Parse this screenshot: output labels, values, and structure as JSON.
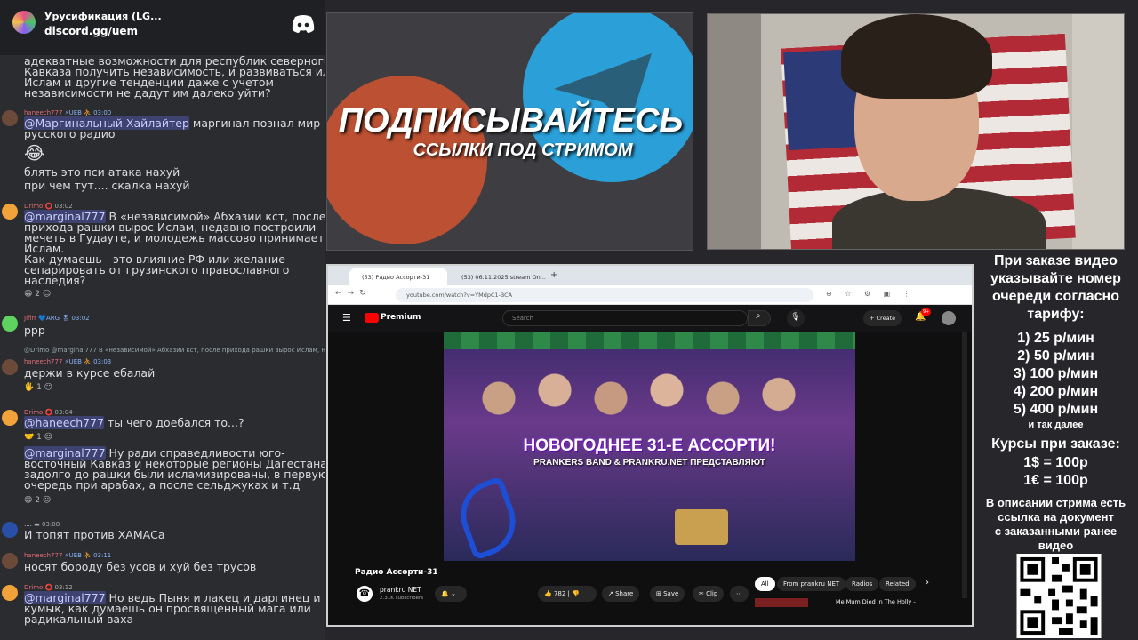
{
  "discord": {
    "title": "Урусификация (LG...",
    "invite": "discord.gg/uem"
  },
  "chat": {
    "m0": {
      "lines": "адекватные возможности для республик северного\nКавказа получить независимость, и развиваться или\nИслам и другие тенденции даже с учетом\nнезависимости не дадут им далеко уйти?"
    },
    "m1": {
      "user": "haneech777",
      "meta": "⚡UEB ⛹ 03:00",
      "mention": "@Маргинальный Хайлайтер",
      "text": " маргинал познал мир",
      "text2": "русского радио"
    },
    "m1b": {
      "emoji": "😂",
      "l1": "блять это пси атака нахуй",
      "l2": "при чем тут.... скалка нахуй"
    },
    "m2": {
      "user": "Drimo",
      "meta": "⭕ 03:02",
      "mention": "@marginal777",
      "text": " В «независимой» Абхазии кст, после",
      "rest": "прихода рашки вырос Ислам, недавно построили\nмечеть в Гудауте, и молодежь массово принимает\nИслам.\nКак думаешь - это влияние РФ или желание\nсепарировать от грузинского православного\nнаследия?",
      "react": "😁 2   ☺"
    },
    "m3": {
      "user": "Jifirr",
      "meta": "💙ARG 🎖 03:02",
      "text": "ррр"
    },
    "m4": {
      "reply": "@Drimo  @marginal777 В «независимой» Абхазии кст, после прихода рашки вырос Ислам, недав...",
      "user": "haneech777",
      "meta": "⚡UEB ⛹ 03:03",
      "text": "держи в курсе ебалай",
      "react": "🖐 1   ☺"
    },
    "m5": {
      "user": "Drimo",
      "meta": "⭕ 03:04",
      "mention": "@haneech777",
      "text": " ты чего доебался то...?",
      "react": "🤝 1   ☺"
    },
    "m6": {
      "mention": "@marginal777",
      "text": " Ну ради справедливости юго-",
      "rest": "восточный Кавказ и некоторые регионы Дагестана\nзадолго до рашки были исламизированы, в первую\nочередь при арабах, а после сельджуках и т.д",
      "react": "😁 2   ☺"
    },
    "m7": {
      "user": "....",
      "meta": "▬ 03:08",
      "text": "И топят против ХАМАСа"
    },
    "m8": {
      "user": "haneech777",
      "meta": "⚡UEB ⛹ 03:11",
      "text": "носят бороду без усов и хуй без трусов"
    },
    "m9": {
      "user": "Drimo",
      "meta": "⭕ 03:12",
      "mention": "@marginal777",
      "text": " Но ведь Пыня и лакец и даргинец и",
      "rest": "кумык, как думаешь он просвященный мага или\nрадикальный ваха"
    }
  },
  "promo": {
    "title": "ПОДПИСЫВАЙТЕСЬ",
    "sub": "ССЫЛКИ ПОД СТРИМОМ"
  },
  "browser": {
    "tab1": "(53) Радио Ассорти-31",
    "tab2": "(53) 06.11.2025 stream On...",
    "url": "youtube.com/watch?v=YMdpC1-BCA",
    "search_ph": "Search",
    "create": "Create",
    "notif": "9+",
    "brand": "Premium",
    "video_title": "Радио Ассорти-31",
    "thumb_title": "НОВОГОДНЕЕ 31-Е АССОРТИ!",
    "thumb_sub": "PRANKERS BAND & PRANKRU.NET ПРЕДСТАВЛЯЮТ",
    "channel": "prankru NET",
    "subs": "2.31K subscribers",
    "likes": "782",
    "share": "Share",
    "save": "Save",
    "clip": "Clip",
    "chips": [
      "All",
      "From prankru NET",
      "Radios",
      "Related"
    ],
    "rec": "Me Mum Died in The Holly -"
  },
  "side": {
    "l1": "При заказе видео",
    "l2": "указывайте номер",
    "l3": "очереди согласно",
    "l4": "тарифу:",
    "p1": "1) 25 р/мин",
    "p2": "2) 50 р/мин",
    "p3": "3) 100 р/мин",
    "p4": "4) 200 р/мин",
    "p5": "5) 400 р/мин",
    "etc": "и так далее",
    "k1": "Курсы при заказе:",
    "k2": "1$ = 100р",
    "k3": "1€ = 100р",
    "d1": "В описании стрима есть",
    "d2": "ссылка на документ",
    "d3": "с заказанными ранее",
    "d4": "видео"
  }
}
